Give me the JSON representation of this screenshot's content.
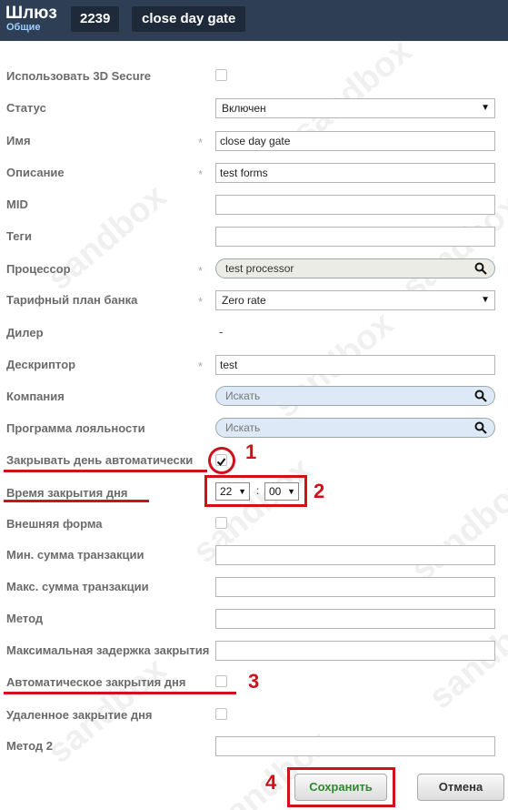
{
  "header": {
    "title": "Шлюз",
    "subtitle": "Общие",
    "gate_id": "2239",
    "gate_name": "close day gate"
  },
  "watermark": "sandbox",
  "fields": {
    "use_3ds": {
      "label": "Использовать 3D Secure",
      "checked": false
    },
    "status": {
      "label": "Статус",
      "value": "Включен"
    },
    "name": {
      "label": "Имя",
      "required_mark": "*",
      "value": "close day gate"
    },
    "description": {
      "label": "Описание",
      "required_mark": "*",
      "value": "test forms"
    },
    "mid": {
      "label": "MID",
      "value": ""
    },
    "tags": {
      "label": "Теги",
      "value": ""
    },
    "processor": {
      "label": "Процессор",
      "required_mark": "*",
      "value": "test processor"
    },
    "bank_plan": {
      "label": "Тарифный план банка",
      "required_mark": "*",
      "value": "Zero rate"
    },
    "dealer": {
      "label": "Дилер",
      "value": "-"
    },
    "descriptor": {
      "label": "Дескриптор",
      "required_mark": "*",
      "value": "test"
    },
    "company": {
      "label": "Компания",
      "placeholder": "Искать"
    },
    "loyalty": {
      "label": "Программа лояльности",
      "placeholder": "Искать"
    },
    "auto_close_day": {
      "label": "Закрывать день автоматически",
      "checked": true
    },
    "close_time": {
      "label": "Время закрытия дня",
      "hour": "22",
      "separator": ":",
      "minute": "00"
    },
    "external_form": {
      "label": "Внешняя форма",
      "checked": false
    },
    "min_amount": {
      "label": "Мин. сумма транзакции",
      "value": ""
    },
    "max_amount": {
      "label": "Макс. сумма транзакции",
      "value": ""
    },
    "method": {
      "label": "Метод",
      "value": ""
    },
    "max_close_delay": {
      "label": "Максимальная задержка закрытия",
      "value": ""
    },
    "auto_close_day2": {
      "label": "Автоматическое закрытия дня",
      "checked": false
    },
    "remote_close_day": {
      "label": "Удаленное закрытие дня",
      "checked": false
    },
    "method2": {
      "label": "Метод 2",
      "value": ""
    }
  },
  "annotations": {
    "n1": "1",
    "n2": "2",
    "n3": "3",
    "n4": "4",
    "color": "#d0101a"
  },
  "buttons": {
    "save": "Сохранить",
    "cancel": "Отмена"
  }
}
